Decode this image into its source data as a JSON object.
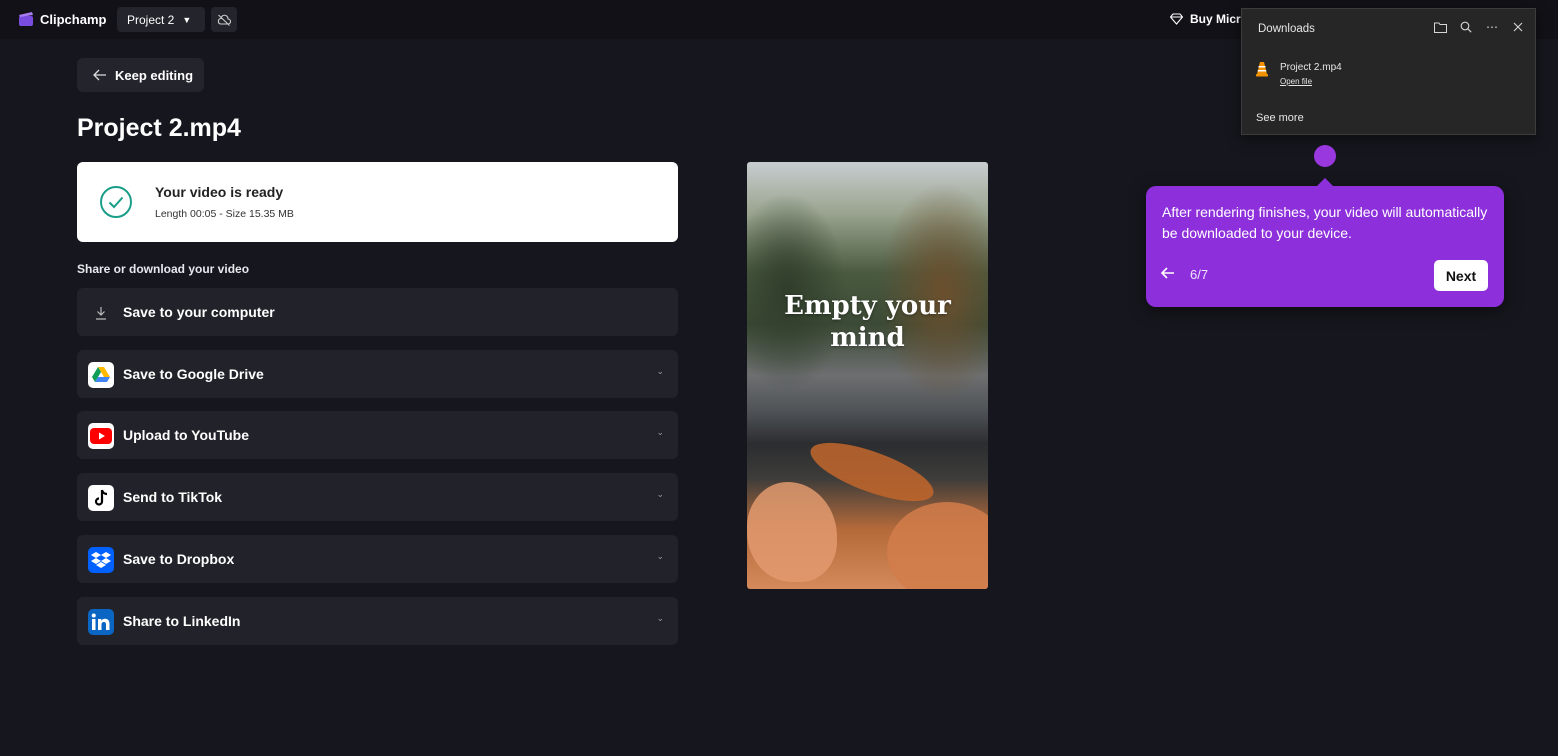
{
  "app": {
    "name": "Clipchamp",
    "project_name": "Project 2",
    "buy_label": "Buy Micro"
  },
  "export": {
    "keep_editing": "Keep editing",
    "file_title": "Project 2.mp4",
    "ready_title": "Your video is ready",
    "ready_subtitle": "Length 00:05 - Size 15.35 MB",
    "share_label": "Share or download your video",
    "options": [
      {
        "label": "Save to your computer",
        "icon": "download-icon"
      },
      {
        "label": "Save to Google Drive",
        "icon": "google-drive-icon"
      },
      {
        "label": "Upload to YouTube",
        "icon": "youtube-icon"
      },
      {
        "label": "Send to TikTok",
        "icon": "tiktok-icon"
      },
      {
        "label": "Save to Dropbox",
        "icon": "dropbox-icon"
      },
      {
        "label": "Share to LinkedIn",
        "icon": "linkedin-icon"
      }
    ],
    "preview_caption": "Empty your mind"
  },
  "downloads": {
    "title": "Downloads",
    "file_name": "Project 2.mp4",
    "open_file": "Open file",
    "see_more": "See more"
  },
  "tour": {
    "text": "After rendering finishes, your video will automatically be downloaded to your device.",
    "step": "6/7",
    "next_label": "Next"
  },
  "colors": {
    "accent": "#8e2fdc",
    "success": "#1a9e8a",
    "background": "#16161e"
  }
}
